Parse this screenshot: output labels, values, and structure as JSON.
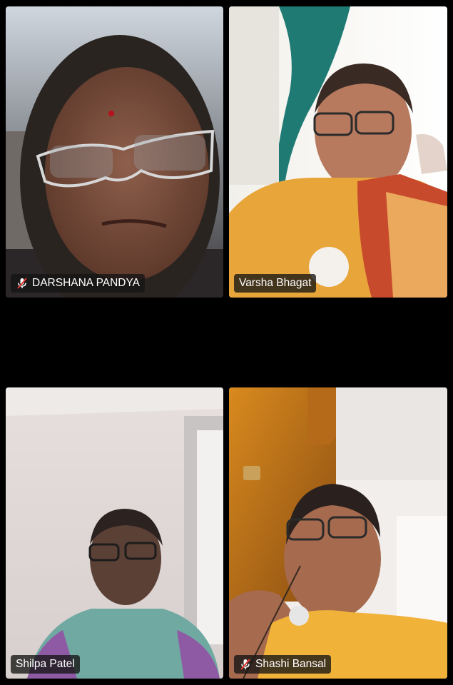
{
  "participants": [
    {
      "name": "DARSHANA PANDYA",
      "muted": true,
      "icon": "mic-muted-icon"
    },
    {
      "name": "Varsha Bhagat",
      "muted": false,
      "icon": ""
    },
    {
      "name": "Shilpa Patel",
      "muted": false,
      "icon": ""
    },
    {
      "name": "Shashi Bansal",
      "muted": true,
      "icon": "mic-muted-icon"
    }
  ],
  "colors": {
    "background": "#000000",
    "name_tag_bg": "#141414",
    "name_tag_text": "#ffffff",
    "muted_slash": "#e53935"
  }
}
